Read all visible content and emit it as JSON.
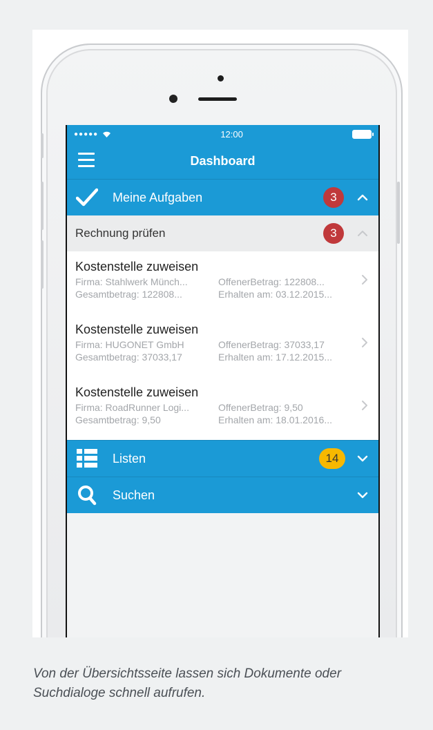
{
  "status": {
    "time": "12:00"
  },
  "nav": {
    "title": "Dashboard"
  },
  "sections": {
    "aufgaben": {
      "label": "Meine Aufgaben",
      "count": "3"
    },
    "listen": {
      "label": "Listen",
      "count": "14"
    },
    "suchen": {
      "label": "Suchen"
    }
  },
  "group": {
    "label": "Rechnung prüfen",
    "count": "3"
  },
  "tasks": [
    {
      "title": "Kostenstelle zuweisen",
      "firma": "Firma: Stahlwerk Münch...",
      "offen": "OffenerBetrag: 122808...",
      "gesamt": "Gesamtbetrag: 122808...",
      "erhalten": "Erhalten am: 03.12.2015..."
    },
    {
      "title": "Kostenstelle zuweisen",
      "firma": "Firma: HUGONET GmbH",
      "offen": "OffenerBetrag: 37033,17",
      "gesamt": "Gesamtbetrag: 37033,17",
      "erhalten": "Erhalten am: 17.12.2015..."
    },
    {
      "title": "Kostenstelle zuweisen",
      "firma": "Firma: RoadRunner Logi...",
      "offen": "OffenerBetrag: 9,50",
      "gesamt": "Gesamtbetrag: 9,50",
      "erhalten": "Erhalten am: 18.01.2016..."
    }
  ],
  "caption": "Von der Übersichtsseite lassen sich Dokumente oder Suchdialoge schnell aufrufen.",
  "icons": {
    "menu": "hamburger-icon",
    "check": "checkmark-icon",
    "list": "list-icon",
    "search": "search-icon",
    "chevron_up": "chevron-up-icon",
    "chevron_down": "chevron-down-icon",
    "chevron_right": "chevron-right-icon",
    "wifi": "wifi-icon",
    "battery": "battery-icon"
  },
  "colors": {
    "accent": "#1b9ad6",
    "badge_red": "#c0393b",
    "badge_yellow": "#f7b800"
  }
}
